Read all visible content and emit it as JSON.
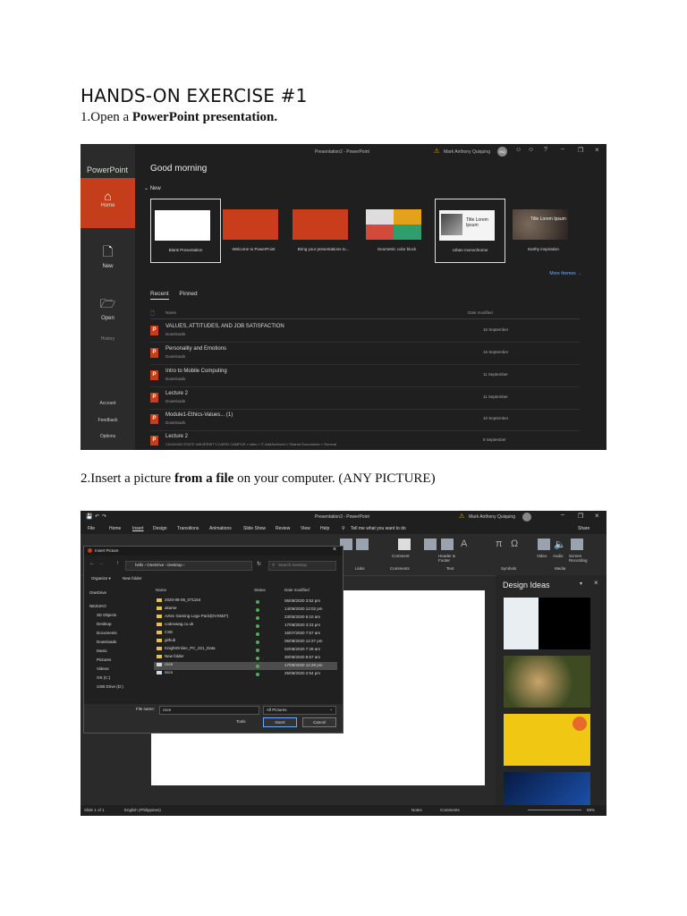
{
  "heading": "HANDS-ON EXERCISE #1",
  "step1": {
    "prefix": "1.Open a ",
    "bold": "PowerPoint presentation."
  },
  "step2": {
    "prefix": "2.Insert a picture ",
    "bold": "from a file",
    "suffix": " on your computer. (ANY PICTURE)"
  },
  "shot1": {
    "window_title": "Presentation2 - PowerPoint",
    "user_name": "Mark Anthony Quiquing",
    "user_initials": "MQ",
    "app_name": "PowerPoint",
    "greeting": "Good morning",
    "new_label": "New",
    "nav": {
      "home": "Home",
      "new": "New",
      "open": "Open",
      "history": "History",
      "account": "Account",
      "feedback": "Feedback",
      "options": "Options"
    },
    "templates": [
      "Blank Presentation",
      "Welcome to PowerPoint",
      "Bring your presentations to...",
      "Geometric color block",
      "Urban monochrome",
      "Earthy inspiration"
    ],
    "urban_thumb_text": "Title Lorem Ipsum",
    "earthy_thumb_text": "Title Lorem Ipsum",
    "more_themes": "More themes →",
    "tabs": [
      "Recent",
      "Pinned"
    ],
    "col_name": "Name",
    "col_date": "Date modified",
    "files": [
      {
        "name": "VALUES, ATTITUDES, AND JOB SATISFACTION",
        "location": "Downloads",
        "date": "15 September"
      },
      {
        "name": "Personality and Emotions",
        "location": "Downloads",
        "date": "15 September"
      },
      {
        "name": "Intro to Mobile Computing",
        "location": "Downloads",
        "date": "11 September"
      },
      {
        "name": "Lecture 2",
        "location": "Downloads",
        "date": "11 September"
      },
      {
        "name": "Module1-Ethics-Values... (1)",
        "location": "Downloads",
        "date": "10 September"
      },
      {
        "name": "Lecture 2",
        "location": "CAGAYAN STATE UNIVERSITY-CARIG CAMPUS » sites » IT-AddArchived » Shared Documents » General",
        "date": "9 September"
      }
    ]
  },
  "shot2": {
    "window_title": "Presentation3 - PowerPoint",
    "user_name": "Mark Anthony Quiquing",
    "share": "Share",
    "menu": [
      "File",
      "Home",
      "Insert",
      "Design",
      "Transitions",
      "Animations",
      "Slide Show",
      "Review",
      "View",
      "Help"
    ],
    "tell_me": "Tell me what you want to do",
    "ribbon_labels": [
      "Comment",
      "Header & Footer",
      "Video",
      "Audio",
      "Screen Recording"
    ],
    "ribbon_groups": [
      "Links",
      "Comments",
      "Text",
      "Symbols",
      "Media"
    ],
    "design_ideas": "Design Ideas",
    "status_left": "Slide 1 of 1",
    "status_lang": "English (Philippines)",
    "status_notes": "Notes",
    "status_comments": "Comments",
    "status_zoom": "69%",
    "dialog": {
      "title": "Insert Picture",
      "breadcrumb": "hells › OneDrive › Desktop ›",
      "search_placeholder": "Search Desktop",
      "organize": "Organize ▾",
      "new_folder": "New folder",
      "nav_items": [
        "OneDrive",
        "NEZUKO",
        "3D Objects",
        "Desktop",
        "Documents",
        "Downloads",
        "Music",
        "Pictures",
        "Videos",
        "OS (C:)",
        "USB Drive (D:)"
      ],
      "col_name": "Name",
      "col_status": "Status",
      "col_date": "Date modified",
      "rows": [
        {
          "name": "2020-08-06_071154",
          "date": "06/08/2020 3:52 pm"
        },
        {
          "name": "akame",
          "date": "14/09/2020 12:02 pm"
        },
        {
          "name": "Aztec Gaming Logo Pack(DVXMZ*)",
          "date": "23/05/2020 6:10 am"
        },
        {
          "name": "codexwag.co.uk",
          "date": "17/08/2020 3:23 pm"
        },
        {
          "name": "CSE",
          "date": "16/07/2020 7:57 am"
        },
        {
          "name": "github",
          "date": "06/08/2020 12:27 pm"
        },
        {
          "name": "KnightOnline_PC_221_Data",
          "date": "02/08/2020 7:28 am"
        },
        {
          "name": "New folder",
          "date": "30/08/2020 8:57 am"
        },
        {
          "name": "csce",
          "date": "17/08/2020 12:29 pm"
        },
        {
          "name": "sscs",
          "date": "25/08/2020 2:54 pm"
        }
      ],
      "file_name_label": "File name:",
      "file_name_value": "csce",
      "filter": "All Pictures",
      "tools": "Tools",
      "insert": "Insert",
      "cancel": "Cancel"
    }
  }
}
